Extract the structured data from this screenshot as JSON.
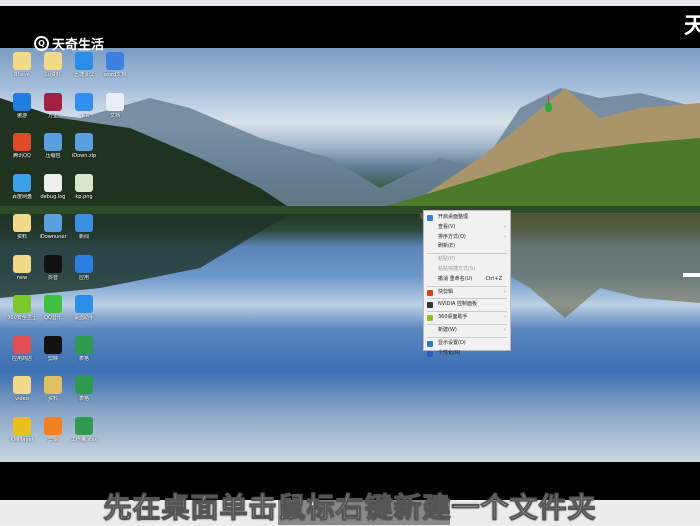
{
  "watermark": {
    "brand": "天奇生活",
    "corner_char": "天"
  },
  "desktop": {
    "icons": [
      {
        "label": "Rhave",
        "color": "#f3d98a"
      },
      {
        "label": "Lu资料",
        "color": "#f3d98a"
      },
      {
        "label": "迅捷录屏",
        "color": "#2b8ee6"
      },
      {
        "label": "word文档",
        "color": "#3f7fe0"
      },
      {
        "label": "傲游",
        "color": "#1f7ee0"
      },
      {
        "label": "方正",
        "color": "#a02040"
      },
      {
        "label": "飞书",
        "color": "#2f8ef0"
      },
      {
        "label": "文档",
        "color": "#e9eef8"
      },
      {
        "label": "腾讯QQ",
        "color": "#e04a2a"
      },
      {
        "label": "压缩包",
        "color": "#5aa0e0"
      },
      {
        "label": "iDown.zip",
        "color": "#5aa0e0"
      },
      {
        "label": "",
        "color": "transparent"
      },
      {
        "label": "百度网盘",
        "color": "#3aa0e8"
      },
      {
        "label": "debug.log",
        "color": "#eeeeee"
      },
      {
        "label": "kp.png",
        "color": "#d8e8d0"
      },
      {
        "label": "",
        "color": "transparent"
      },
      {
        "label": "资料",
        "color": "#f3d98a"
      },
      {
        "label": "iDownuner",
        "color": "#5aa0e0"
      },
      {
        "label": "新闻",
        "color": "#3a8fe0"
      },
      {
        "label": "",
        "color": "transparent"
      },
      {
        "label": "new",
        "color": "#f3d98a"
      },
      {
        "label": "抖音",
        "color": "#111111"
      },
      {
        "label": "应用",
        "color": "#2a7fe0"
      },
      {
        "label": "",
        "color": "transparent"
      },
      {
        "label": "360安全卫士",
        "color": "#7ac82a"
      },
      {
        "label": "QQ音乐",
        "color": "#40c040"
      },
      {
        "label": "桌面助手",
        "color": "#2a90e8"
      },
      {
        "label": "",
        "color": "transparent"
      },
      {
        "label": "应用商店",
        "color": "#e05050"
      },
      {
        "label": "剪映",
        "color": "#111111"
      },
      {
        "label": "表格",
        "color": "#2f9a50"
      },
      {
        "label": "",
        "color": "transparent"
      },
      {
        "label": "video",
        "color": "#f3d98a"
      },
      {
        "label": "资料",
        "color": "#e0c060"
      },
      {
        "label": "表格",
        "color": "#2f9a50"
      },
      {
        "label": "",
        "color": "transparent"
      },
      {
        "label": "KMPlayer",
        "color": "#e8c020"
      },
      {
        "label": "剪辑",
        "color": "#f08020"
      },
      {
        "label": "工作簿.xlsx",
        "color": "#2f9a50"
      },
      {
        "label": "",
        "color": "transparent"
      }
    ]
  },
  "context_menu": {
    "items": [
      {
        "label": "开启桌面整理",
        "icon": "organize-icon",
        "color": "#3a7fe0"
      },
      {
        "label": "查看(V)",
        "submenu": true
      },
      {
        "label": "排序方式(O)",
        "submenu": true
      },
      {
        "label": "刷新(E)",
        "sep_after": true
      },
      {
        "label": "粘贴(P)",
        "disabled": true
      },
      {
        "label": "粘贴快捷方式(S)",
        "disabled": true
      },
      {
        "label": "撤消 重命名(U)",
        "shortcut": "Ctrl+Z",
        "sep_after": true
      },
      {
        "label": "快剪辑",
        "submenu": true,
        "icon": "kuaijianji-icon",
        "color": "#d84020",
        "sep_after": true
      },
      {
        "label": "NVIDIA 控制面板",
        "icon": "nvidia-icon",
        "color": "#333333",
        "sep_after": true
      },
      {
        "label": "360桌面助手",
        "submenu": true,
        "icon": "360-icon",
        "color": "#8ac020",
        "sep_after": true
      },
      {
        "label": "新建(W)",
        "submenu": true,
        "sep_after": true
      },
      {
        "label": "显示设置(D)",
        "icon": "display-icon",
        "color": "#2a80d0"
      },
      {
        "label": "个性化(R)",
        "icon": "personalize-icon",
        "color": "#2a60c0"
      }
    ]
  },
  "subtitle": "先在桌面单击鼠标右键新建一个文件夹"
}
